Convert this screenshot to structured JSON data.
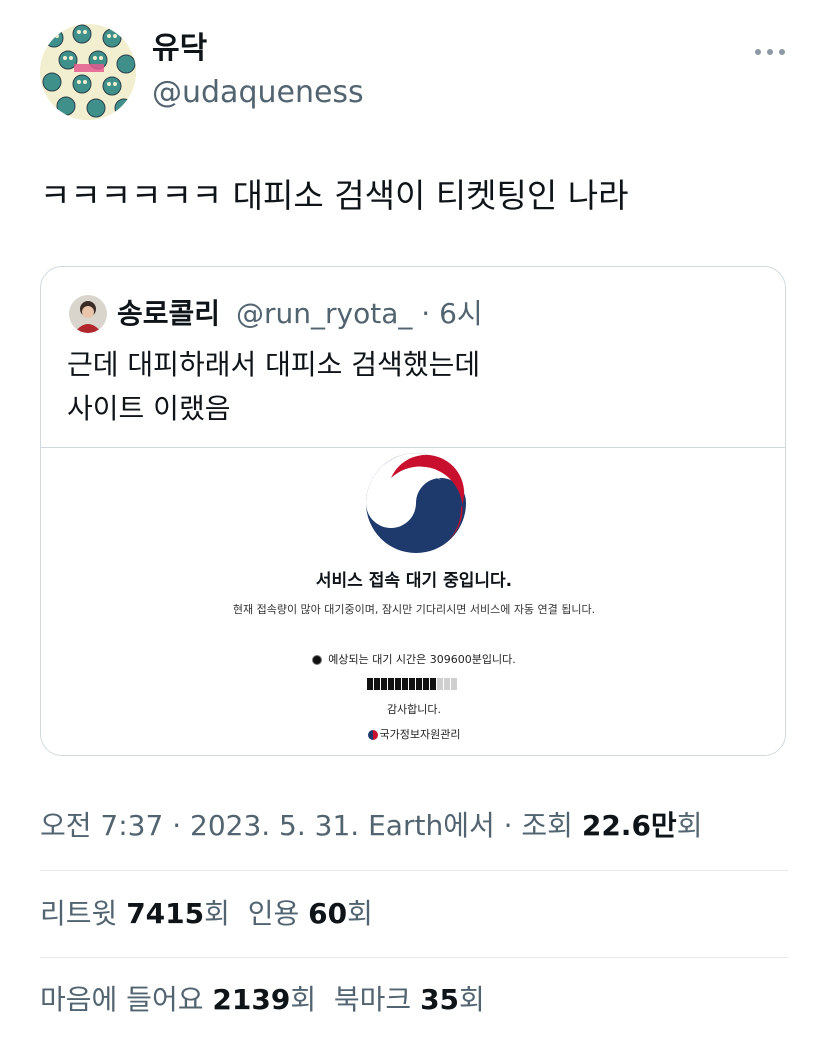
{
  "author": {
    "display_name": "유닥",
    "handle": "@udaqueness",
    "avatar_icon": "avatar-pattern-icon"
  },
  "tweet": {
    "text": "ㅋㅋㅋㅋㅋㅋ 대피소 검색이 티켓팅인 나라"
  },
  "quote": {
    "display_name": "송로콜리",
    "handle": "@run_ryota_",
    "time": "· 6시",
    "line1": "근데 대피하래서 대피소 검색했는데",
    "line2": "사이트 이랬음",
    "media": {
      "title": "서비스 접속 대기 중입니다.",
      "description": "현재 접속량이 많아 대기중이며, 잠시만 기다리시면 서비스에 자동 연결 됩니다.",
      "wait_text": "예상되는 대기 시간은 309600분입니다.",
      "progress_filled": 10,
      "progress_total": 13,
      "thanks": "감사합니다.",
      "footer": "국가정보자원관리"
    }
  },
  "meta": {
    "time_prefix": "오전 7:37 · 2023. 5. 31. Earth에서 · 조회 ",
    "views": "22.6만",
    "views_suffix": "회"
  },
  "stats": {
    "retweets_label": "리트윗 ",
    "retweets": "7415",
    "retweets_suffix": "회",
    "quotes_label": "인용 ",
    "quotes": "60",
    "quotes_suffix": "회",
    "likes_label": "마음에 들어요 ",
    "likes": "2139",
    "likes_suffix": "회",
    "bookmarks_label": "북마크 ",
    "bookmarks": "35",
    "bookmarks_suffix": "회"
  },
  "colors": {
    "secondary_text": "#536471",
    "border": "#cfd9de",
    "emblem_red": "#c8102e",
    "emblem_blue": "#1e3a6d"
  }
}
